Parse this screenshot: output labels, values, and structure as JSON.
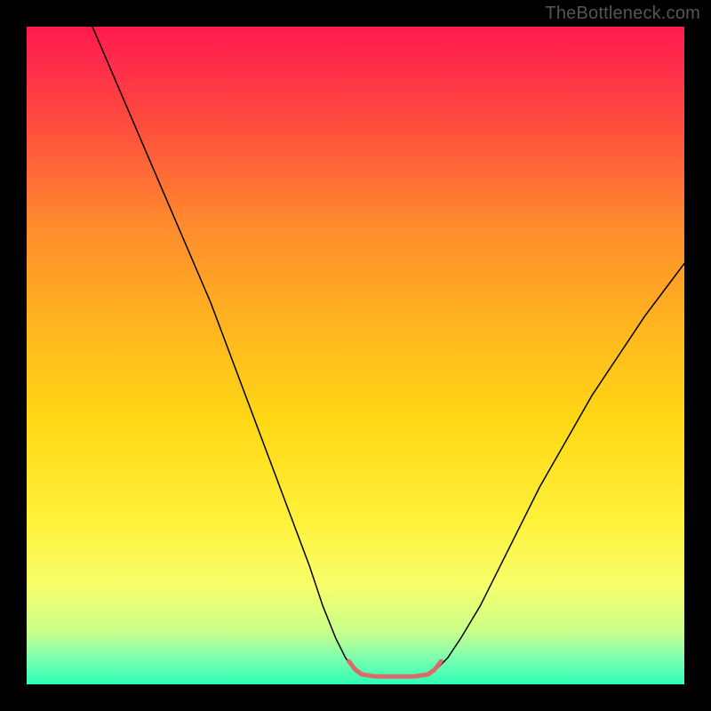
{
  "watermark": "TheBottleneck.com",
  "chart_data": {
    "type": "line",
    "title": "",
    "xlabel": "",
    "ylabel": "",
    "xlim": [
      0,
      100
    ],
    "ylim": [
      0,
      100
    ],
    "gradient_stops": [
      {
        "offset": 0.0,
        "color": "#ff1a4d"
      },
      {
        "offset": 0.05,
        "color": "#ff2a4a"
      },
      {
        "offset": 0.15,
        "color": "#ff4d3d"
      },
      {
        "offset": 0.3,
        "color": "#ff8a2e"
      },
      {
        "offset": 0.45,
        "color": "#ffb41f"
      },
      {
        "offset": 0.6,
        "color": "#ffd815"
      },
      {
        "offset": 0.75,
        "color": "#fff13a"
      },
      {
        "offset": 0.85,
        "color": "#f7ff6a"
      },
      {
        "offset": 0.92,
        "color": "#c8ff8a"
      },
      {
        "offset": 0.96,
        "color": "#7dffb0"
      },
      {
        "offset": 1.0,
        "color": "#2dffb5"
      }
    ],
    "series": [
      {
        "name": "left-curve",
        "stroke": "#000000",
        "stroke_width": 1.5,
        "x": [
          10,
          13,
          16,
          19,
          22,
          25,
          28,
          31,
          34,
          37,
          40,
          43,
          45,
          47,
          48.5,
          50
        ],
        "y": [
          100,
          93,
          86,
          79,
          72,
          65,
          58,
          50,
          42,
          34,
          26,
          18,
          12,
          7,
          4,
          2
        ]
      },
      {
        "name": "right-curve",
        "stroke": "#000000",
        "stroke_width": 1.5,
        "x": [
          62,
          64,
          66,
          69,
          72,
          75,
          78,
          82,
          86,
          90,
          94,
          97,
          100
        ],
        "y": [
          2,
          4,
          7,
          12,
          18,
          24,
          30,
          37,
          44,
          50,
          56,
          60,
          64
        ]
      },
      {
        "name": "bottom-marker",
        "stroke": "#dd6a6a",
        "stroke_width": 5,
        "x": [
          49,
          50,
          51,
          53,
          55,
          57,
          59,
          61,
          62,
          63
        ],
        "y": [
          3.5,
          2.2,
          1.5,
          1.2,
          1.2,
          1.2,
          1.2,
          1.5,
          2.2,
          3.5
        ]
      }
    ]
  }
}
